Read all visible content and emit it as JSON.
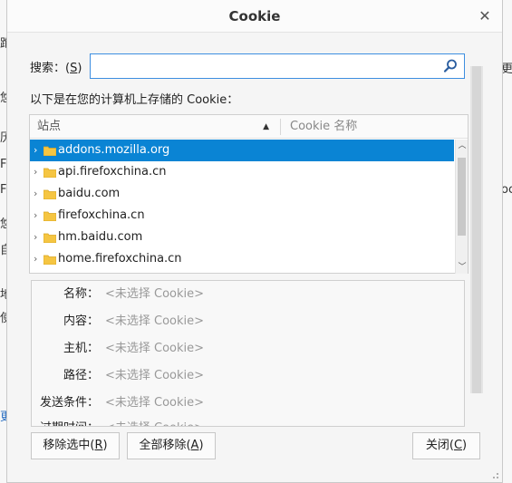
{
  "background": {
    "left_glyphs": [
      "跑",
      "悠",
      "历",
      "F",
      "F",
      "悠",
      "自",
      "地",
      "使",
      "更"
    ],
    "right_glyphs": [
      "更",
      "oc"
    ]
  },
  "dialog": {
    "title": "Cookie",
    "close_icon": "close-icon"
  },
  "search": {
    "label_prefix": "搜索：(",
    "label_key": "S",
    "label_suffix": ")",
    "value": "",
    "placeholder": ""
  },
  "info_text": "以下是在您的计算机上存储的 Cookie：",
  "tree": {
    "columns": {
      "site": "站点",
      "cookie_name": "Cookie 名称"
    },
    "sort_indicator": "▲",
    "rows": [
      {
        "label": "addons.mozilla.org",
        "selected": true
      },
      {
        "label": "api.firefoxchina.cn",
        "selected": false
      },
      {
        "label": "baidu.com",
        "selected": false
      },
      {
        "label": "firefoxchina.cn",
        "selected": false
      },
      {
        "label": "hm.baidu.com",
        "selected": false
      },
      {
        "label": "home.firefoxchina.cn",
        "selected": false
      }
    ]
  },
  "details": {
    "fields": [
      {
        "label": "名称：",
        "value": "<未选择 Cookie>"
      },
      {
        "label": "内容：",
        "value": "<未选择 Cookie>"
      },
      {
        "label": "主机：",
        "value": "<未选择 Cookie>"
      },
      {
        "label": "路径：",
        "value": "<未选择 Cookie>"
      },
      {
        "label": "发送条件：",
        "value": "<未选择 Cookie>"
      },
      {
        "label": "过期时间：",
        "value": "<未选择 Cookie>"
      }
    ]
  },
  "buttons": {
    "remove_selected_prefix": "移除选中(",
    "remove_selected_key": "R",
    "remove_selected_suffix": ")",
    "remove_all_prefix": "全部移除(",
    "remove_all_key": "A",
    "remove_all_suffix": ")",
    "close_prefix": "关闭(",
    "close_key": "C",
    "close_suffix": ")"
  },
  "colors": {
    "selection": "#0a84d4",
    "focus_border": "#3d8ee0",
    "folder": "#f5c542"
  }
}
